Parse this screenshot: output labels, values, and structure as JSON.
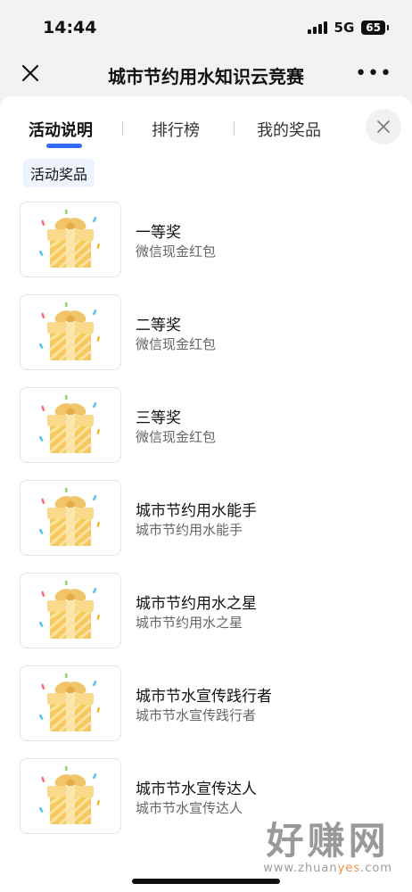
{
  "status_bar": {
    "time": "14:44",
    "network": "5G",
    "battery": "65"
  },
  "nav": {
    "title": "城市节约用水知识云竞赛"
  },
  "tabs": [
    {
      "label": "活动说明",
      "active": true
    },
    {
      "label": "排行榜",
      "active": false
    },
    {
      "label": "我的奖品",
      "active": false
    }
  ],
  "section": {
    "title": "活动奖品"
  },
  "prizes": [
    {
      "name": "一等奖",
      "desc": "微信现金红包"
    },
    {
      "name": "二等奖",
      "desc": "微信现金红包"
    },
    {
      "name": "三等奖",
      "desc": "微信现金红包"
    },
    {
      "name": "城市节约用水能手",
      "desc": "城市节约用水能手"
    },
    {
      "name": "城市节约用水之星",
      "desc": "城市节约用水之星"
    },
    {
      "name": "城市节水宣传践行者",
      "desc": "城市节水宣传践行者"
    },
    {
      "name": "城市节水宣传达人",
      "desc": "城市节水宣传达人"
    }
  ],
  "watermark": {
    "logo": "好赚网",
    "url_prefix": "www.zhuan",
    "url_highlight": "yes",
    "url_suffix": ".com"
  },
  "icons": {
    "close": "close-icon",
    "more": "more-icon",
    "gift": "gift-box-icon"
  },
  "colors": {
    "accent": "#2f6bff",
    "chip_bg": "#eef4ff",
    "gift": "#f6c95d"
  }
}
